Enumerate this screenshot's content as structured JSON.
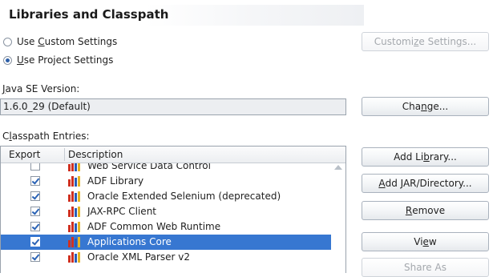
{
  "header": {
    "title": "Libraries and Classpath"
  },
  "settings": {
    "custom": {
      "pre": "Use ",
      "key": "C",
      "post": "ustom Settings",
      "checked": false
    },
    "project": {
      "pre": "",
      "key": "U",
      "post": "se Project Settings",
      "checked": true
    },
    "customize_button": {
      "pre": "Customi",
      "key": "z",
      "post": "e Settings..."
    }
  },
  "java": {
    "label_key": "J",
    "label_post": "ava SE Version:",
    "value": "1.6.0_29 (Default)",
    "change_button": {
      "pre": "Cha",
      "key": "n",
      "post": "ge..."
    }
  },
  "classpath": {
    "label_pre": "C",
    "label_key": "l",
    "label_post": "asspath Entries:",
    "columns": {
      "export": "Export",
      "description": "Description"
    },
    "rows": [
      {
        "checked": false,
        "label": "Web Service Data Control",
        "selected": false
      },
      {
        "checked": true,
        "label": "ADF Library",
        "selected": false
      },
      {
        "checked": true,
        "label": "Oracle Extended Selenium (deprecated)",
        "selected": false
      },
      {
        "checked": true,
        "label": "JAX-RPC Client",
        "selected": false
      },
      {
        "checked": true,
        "label": "ADF Common Web Runtime",
        "selected": false
      },
      {
        "checked": true,
        "label": "Applications Core",
        "selected": true
      },
      {
        "checked": true,
        "label": "Oracle XML Parser v2",
        "selected": false
      }
    ]
  },
  "buttons": {
    "add_library": {
      "pre": "Add Li",
      "key": "b",
      "post": "rary..."
    },
    "add_jar": {
      "pre": "",
      "key": "A",
      "post": "dd JAR/Directory..."
    },
    "remove": {
      "pre": "",
      "key": "R",
      "post": "emove"
    },
    "view": {
      "pre": "Vi",
      "key": "e",
      "post": "w"
    },
    "share_as": {
      "label": "Share As"
    }
  },
  "colors": {
    "selection": "#3777d1",
    "icon_red": "#d03020",
    "icon_blue": "#2a5db8",
    "icon_yellow": "#e6b422"
  }
}
